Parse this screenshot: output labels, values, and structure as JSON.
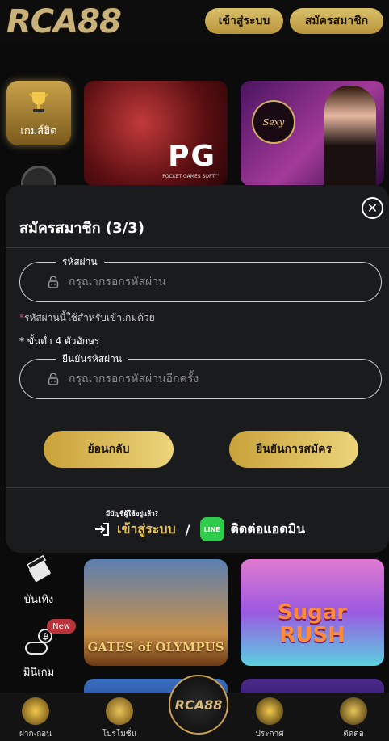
{
  "header": {
    "logo_text": "RCA88",
    "login_label": "เข้าสู่ระบบ",
    "register_label": "สมัครสมาชิก"
  },
  "rail": {
    "hot_label": "เกมส์ฮิต",
    "entertainment_label": "บันเทิง",
    "mini_label": "มินิเกม",
    "new_badge": "New"
  },
  "tiles": {
    "pg_logo": "PG",
    "pg_sub": "POCKET GAMES SOFT™",
    "sexy_logo": "Sexy",
    "olympus_title": "GATES of OLYMPUS",
    "sugar_title_1": "Sugar",
    "sugar_title_2": "RUSH"
  },
  "modal": {
    "title": "สมัครสมาชิก (3/3)",
    "password_legend": "รหัสผ่าน",
    "password_placeholder": "กรุณากรอกรหัสผ่าน",
    "note_star": "*",
    "note_text": "รหัสผ่านนี้ใช้สำหรับเข้าเกมด้วย",
    "min_note": "* ขั้นต่ำ 4 ตัวอักษร",
    "confirm_legend": "ยืนยันรหัสผ่าน",
    "confirm_placeholder": "กรุณากรอกรหัสผ่านอีกครั้ง",
    "back_label": "ย้อนกลับ",
    "submit_label": "ยืนยันการสมัคร",
    "have_account": "มีบัญชีผู้ใช้อยู่แล้ว?",
    "login_link": "เข้าสู่ระบบ",
    "slash": "/",
    "line_badge": "LINE",
    "contact_admin": "ติดต่อแอดมิน",
    "close_symbol": "✕"
  },
  "bottom_nav": {
    "items": [
      {
        "label": "ฝาก-ถอน"
      },
      {
        "label": "โปรโมชั่น"
      },
      {
        "label": "ประกาศ"
      },
      {
        "label": "ติดต่อ"
      }
    ],
    "center_logo": "RCA88"
  },
  "colors": {
    "gold": "#d6bd7e",
    "gold_button": "#c9a23a",
    "line_green": "#2ecc4a",
    "modal_bg": "#1a1b1d",
    "page_bg": "#0b0b0c"
  }
}
